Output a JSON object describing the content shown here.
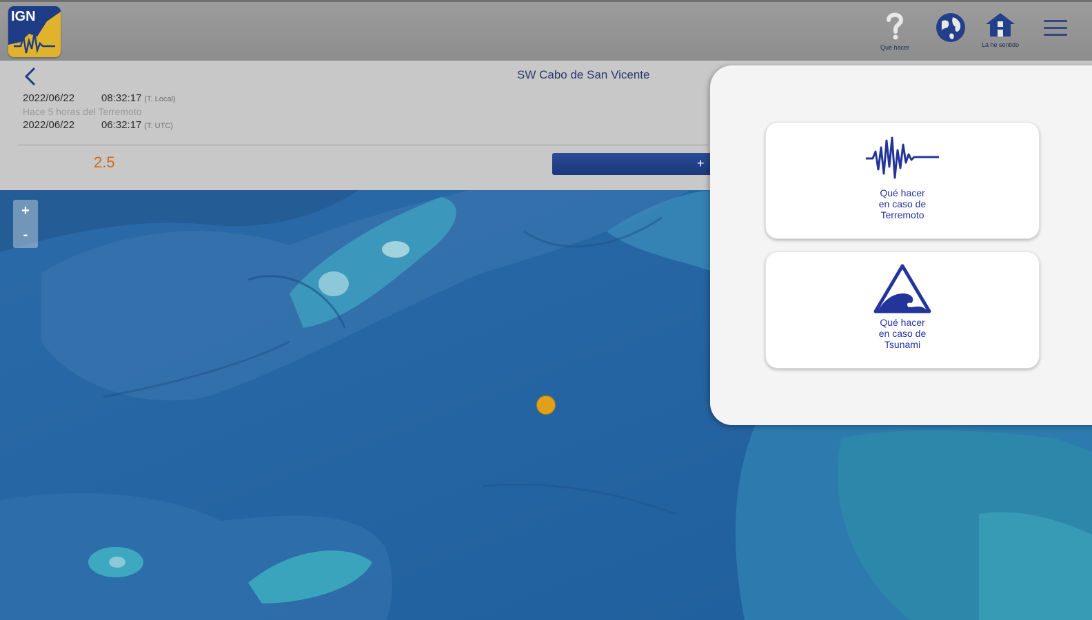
{
  "header": {
    "logo_text": "IGN",
    "icons": [
      {
        "name": "question-icon",
        "label": "Qué hacer"
      },
      {
        "name": "globe-icon",
        "label": ""
      },
      {
        "name": "home-icon",
        "label": "La he sentido"
      },
      {
        "name": "menu-icon",
        "label": ""
      }
    ]
  },
  "event": {
    "region": "SW Cabo de San Vicente",
    "local_date": "2022/06/22",
    "local_time": "08:32:17",
    "local_tag": "(T. Local)",
    "ago": "Hace 5 horas del Terremoto",
    "utc_date": "2022/06/22",
    "utc_time": "06:32:17",
    "utc_tag": "(T. UTC)",
    "magnitude": "2.5",
    "more_label": "+"
  },
  "map": {
    "zoom_in": "+",
    "zoom_out": "-"
  },
  "popup": {
    "cards": [
      {
        "icon": "seismogram-icon",
        "label": "Qué hacer\nen caso de\nTerremoto"
      },
      {
        "icon": "tsunami-icon",
        "label": "Qué hacer\nen caso de\nTsunami"
      }
    ]
  },
  "colors": {
    "brand_blue": "#1f3a80",
    "magnitude": "#c96a1c",
    "quake_marker": "#e0a11a",
    "card_text": "#23349b"
  }
}
